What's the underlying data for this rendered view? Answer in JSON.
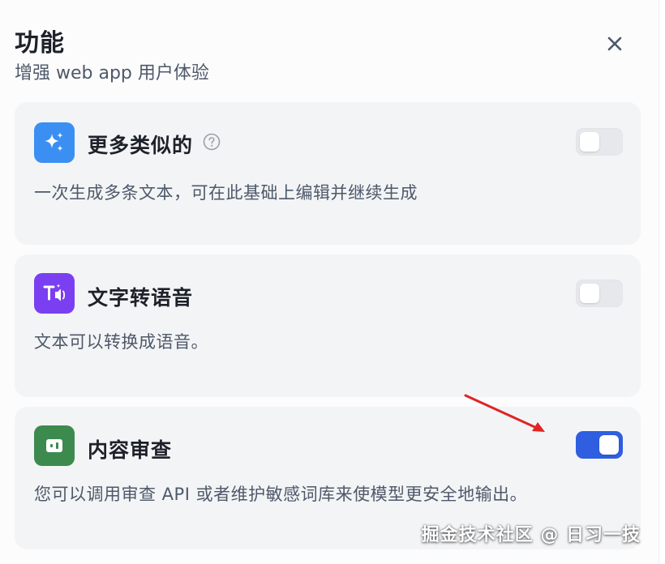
{
  "header": {
    "title": "功能",
    "subtitle": "增强 web app 用户体验",
    "close_icon": "close-icon"
  },
  "features": [
    {
      "title": "更多类似的",
      "description": "一次生成多条文本，可在此基础上编辑并继续生成",
      "icon": "sparkles-icon",
      "icon_color": "#3b8ff3",
      "has_help": true,
      "enabled": false
    },
    {
      "title": "文字转语音",
      "description": "文本可以转换成语音。",
      "icon": "text-to-speech-icon",
      "icon_color": "#7b3ff2",
      "has_help": false,
      "enabled": false
    },
    {
      "title": "内容审查",
      "description": "您可以调用审查 API 或者维护敏感词库来使模型更安全地输出。",
      "icon": "moderation-icon",
      "icon_color": "#3d8a4f",
      "has_help": false,
      "enabled": true
    }
  ],
  "colors": {
    "toggle_on": "#2f5ee0",
    "toggle_off": "#e7e8eb",
    "annotation_arrow": "#e02424"
  },
  "watermark": "掘金技术社区 @ 日习一技"
}
